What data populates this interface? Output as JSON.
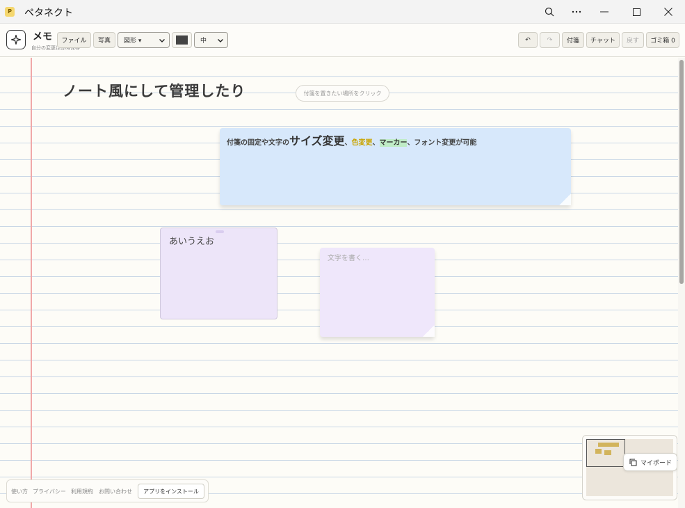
{
  "window": {
    "app_icon_letter": "P",
    "title": "ペタネクト",
    "controls": [
      "search-zoom-icon",
      "more-icon",
      "minimize-icon",
      "maximize-icon",
      "close-icon"
    ]
  },
  "toolbar": {
    "doc_title": "メモ",
    "doc_subtitle": "自分の変更は即時保存",
    "file_label": "ファイル",
    "photo_label": "写真",
    "shape_label": "図形 ▾",
    "size_label": "中",
    "undo_symbol": "↶",
    "redo_symbol": "↷",
    "sticky_label": "付箋",
    "chat_label": "チャット",
    "back_label": "戻す",
    "trash_label": "ゴミ箱 0",
    "pen_color": "#444444"
  },
  "canvas": {
    "heading": "ノート風にして管理したり",
    "hint": "付箋を置きたい場所をクリック",
    "note_blue": {
      "part1": "付箋の固定や文字の",
      "big": "サイズ変更",
      "sep1": "、",
      "yellow": "色変更",
      "sep2": "、",
      "marker": "マーカー",
      "part2": "、フォント変更が可能"
    },
    "note_purple1": {
      "text": "あいうえお"
    },
    "note_purple2": {
      "placeholder": "文字を書く…"
    }
  },
  "footer": {
    "links": [
      "使い方",
      "プライバシー",
      "利用規約",
      "お問い合わせ"
    ],
    "install_label": "アプリをインストール"
  },
  "minimap": {
    "myboard_label": "マイボード"
  },
  "colors": {
    "note_blue": "#d7e8fb",
    "note_purple": "#ede5f9",
    "margin_line": "#f0a8a8",
    "ruled_line": "#c9d7e6",
    "marker": "#bfecc6",
    "yellow_text": "#c9a400"
  }
}
